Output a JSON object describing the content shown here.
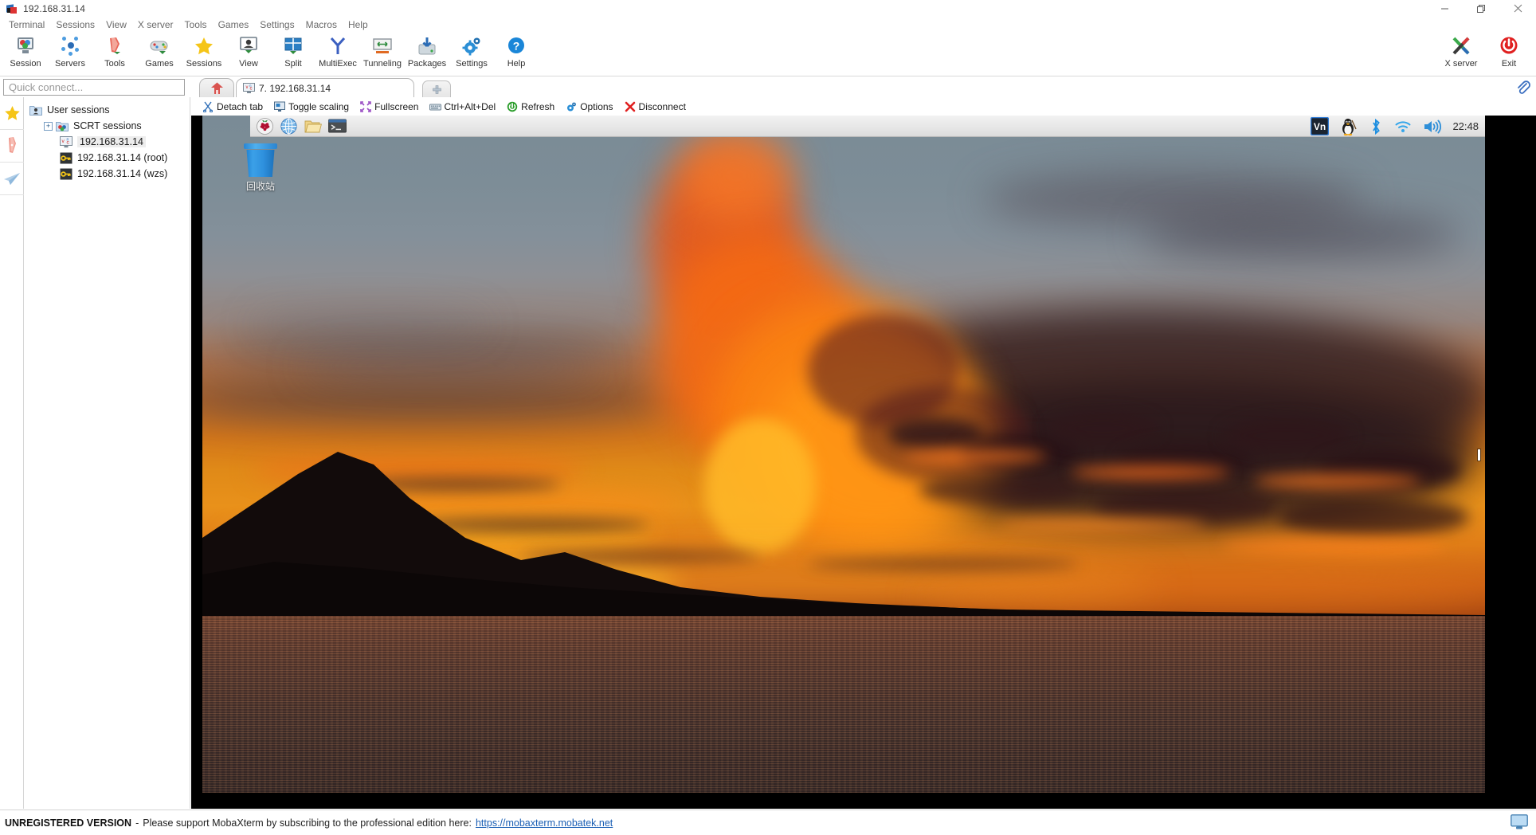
{
  "window": {
    "title": "192.168.31.14",
    "icon": "mobaxterm-icon",
    "controls": [
      {
        "name": "minimize",
        "glyph": "—"
      },
      {
        "name": "maximize",
        "glyph": "❐"
      },
      {
        "name": "close",
        "glyph": "✕"
      }
    ]
  },
  "menubar": {
    "items": [
      {
        "label": "Terminal"
      },
      {
        "label": "Sessions"
      },
      {
        "label": "View"
      },
      {
        "label": "X server"
      },
      {
        "label": "Tools"
      },
      {
        "label": "Games"
      },
      {
        "label": "Settings"
      },
      {
        "label": "Macros"
      },
      {
        "label": "Help"
      }
    ]
  },
  "toolbar": {
    "items": [
      {
        "label": "Session",
        "icon": "session-icon"
      },
      {
        "label": "Servers",
        "icon": "servers-icon"
      },
      {
        "label": "Tools",
        "icon": "tools-icon"
      },
      {
        "label": "Games",
        "icon": "games-icon"
      },
      {
        "label": "Sessions",
        "icon": "sessions-star-icon"
      },
      {
        "label": "View",
        "icon": "view-icon"
      },
      {
        "label": "Split",
        "icon": "split-icon"
      },
      {
        "label": "MultiExec",
        "icon": "multiexec-icon"
      },
      {
        "label": "Tunneling",
        "icon": "tunneling-icon"
      },
      {
        "label": "Packages",
        "icon": "packages-icon"
      },
      {
        "label": "Settings",
        "icon": "settings-gear-icon"
      },
      {
        "label": "Help",
        "icon": "help-icon"
      }
    ],
    "right_items": [
      {
        "label": "X server",
        "icon": "x-server-icon"
      },
      {
        "label": "Exit",
        "icon": "exit-power-icon"
      }
    ]
  },
  "quick_connect": {
    "placeholder": "Quick connect...",
    "value": ""
  },
  "tabs": {
    "home_tab_icon": "home-icon",
    "new_tab_icon": "plus-icon",
    "items": [
      {
        "label": "7. 192.168.31.14",
        "icon": "vnc-session-icon",
        "active": true
      }
    ]
  },
  "vnc_toolbar": {
    "buttons": [
      {
        "label": "Detach tab",
        "icon": "scissors-icon"
      },
      {
        "label": "Toggle scaling",
        "icon": "monitor-scale-icon"
      },
      {
        "label": "Fullscreen",
        "icon": "fullscreen-icon"
      },
      {
        "label": "Ctrl+Alt+Del",
        "icon": "keyboard-icon"
      },
      {
        "label": "Refresh",
        "icon": "refresh-icon"
      },
      {
        "label": "Options",
        "icon": "options-gear-icon"
      },
      {
        "label": "Disconnect",
        "icon": "disconnect-x-icon"
      }
    ]
  },
  "sidebar": {
    "strip": [
      {
        "name": "favorites",
        "icon": "star-icon"
      },
      {
        "name": "tools",
        "icon": "swiss-knife-icon"
      },
      {
        "name": "macros",
        "icon": "paper-plane-icon"
      }
    ],
    "tree": [
      {
        "label": "User sessions",
        "icon": "user-sessions-icon",
        "indent": 0,
        "expander": false,
        "selected": false
      },
      {
        "label": "SCRT sessions",
        "icon": "folder-sessions-icon",
        "indent": 1,
        "expander": true,
        "selected": false
      },
      {
        "label": "192.168.31.14",
        "icon": "vnc-session-icon",
        "indent": 2,
        "expander": false,
        "selected": true
      },
      {
        "label": "192.168.31.14 (root)",
        "icon": "ssh-key-icon",
        "indent": 2,
        "expander": false,
        "selected": false
      },
      {
        "label": "192.168.31.14 (wzs)",
        "icon": "ssh-key-icon",
        "indent": 2,
        "expander": false,
        "selected": false
      }
    ]
  },
  "remote_desktop": {
    "panel": {
      "launchers": [
        {
          "name": "raspberry-menu-icon"
        },
        {
          "name": "web-browser-icon"
        },
        {
          "name": "file-manager-icon"
        },
        {
          "name": "terminal-icon"
        }
      ],
      "tray": [
        {
          "name": "vnc-tray-icon",
          "label": "VNC"
        },
        {
          "name": "tux-penguin-icon",
          "label": ""
        },
        {
          "name": "bluetooth-icon",
          "label": ""
        },
        {
          "name": "wifi-icon",
          "label": ""
        },
        {
          "name": "volume-icon",
          "label": ""
        }
      ],
      "clock": "22:48"
    },
    "desktop_icons": [
      {
        "label": "回收站",
        "icon": "trash-icon"
      }
    ],
    "wallpaper_description": "sunset-clouds-over-lake"
  },
  "statusbar": {
    "unregistered": "UNREGISTERED VERSION",
    "dash": "-",
    "message": "Please support MobaXterm by subscribing to the professional edition here:",
    "link": "https://mobaxterm.mobatek.net",
    "right_icon": "display-icon"
  },
  "colors": {
    "accent_blue": "#1a5fb4",
    "exit_red": "#e02020",
    "tab_bg": "#ffffff",
    "panel_bg": "#e7e7e7"
  }
}
